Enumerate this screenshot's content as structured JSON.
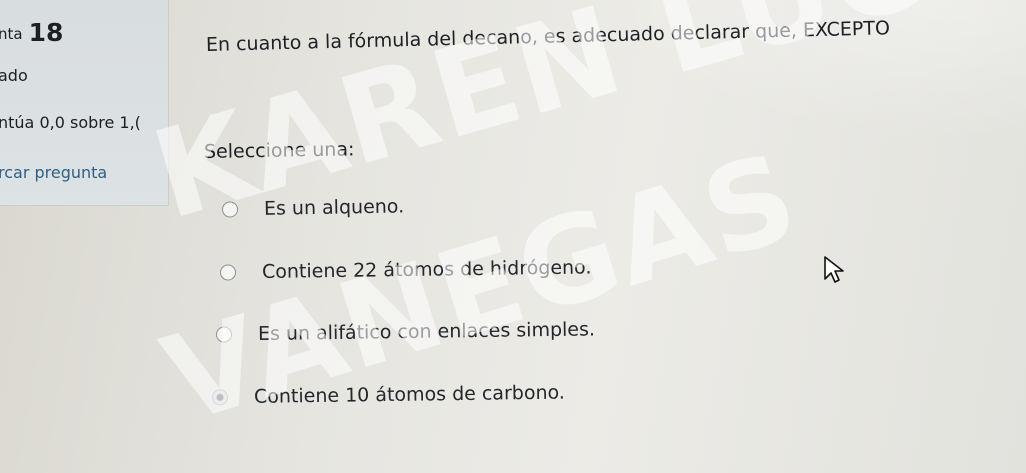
{
  "info": {
    "question_label": "nta",
    "question_number": "18",
    "status": "ado",
    "score": "ntúa 0,0 sobre 1,(",
    "flag": "rcar pregunta"
  },
  "question": {
    "text": "En cuanto a la fórmula del decano, es adecuado declarar que, EXCEPTO",
    "prompt": "Seleccione una:",
    "options": [
      {
        "label": "Es un alqueno.",
        "selected": false
      },
      {
        "label": "Contiene 22 átomos de hidrógeno.",
        "selected": false
      },
      {
        "label": "Es un alifático con enlaces simples.",
        "selected": false
      },
      {
        "label": "Contiene 10 átomos de carbono.",
        "selected": true
      }
    ]
  },
  "watermark": {
    "line1": "KAREN LUCIA GA",
    "line2": "VANEGAS"
  },
  "icons": {
    "cursor": "mouse-pointer-icon"
  }
}
